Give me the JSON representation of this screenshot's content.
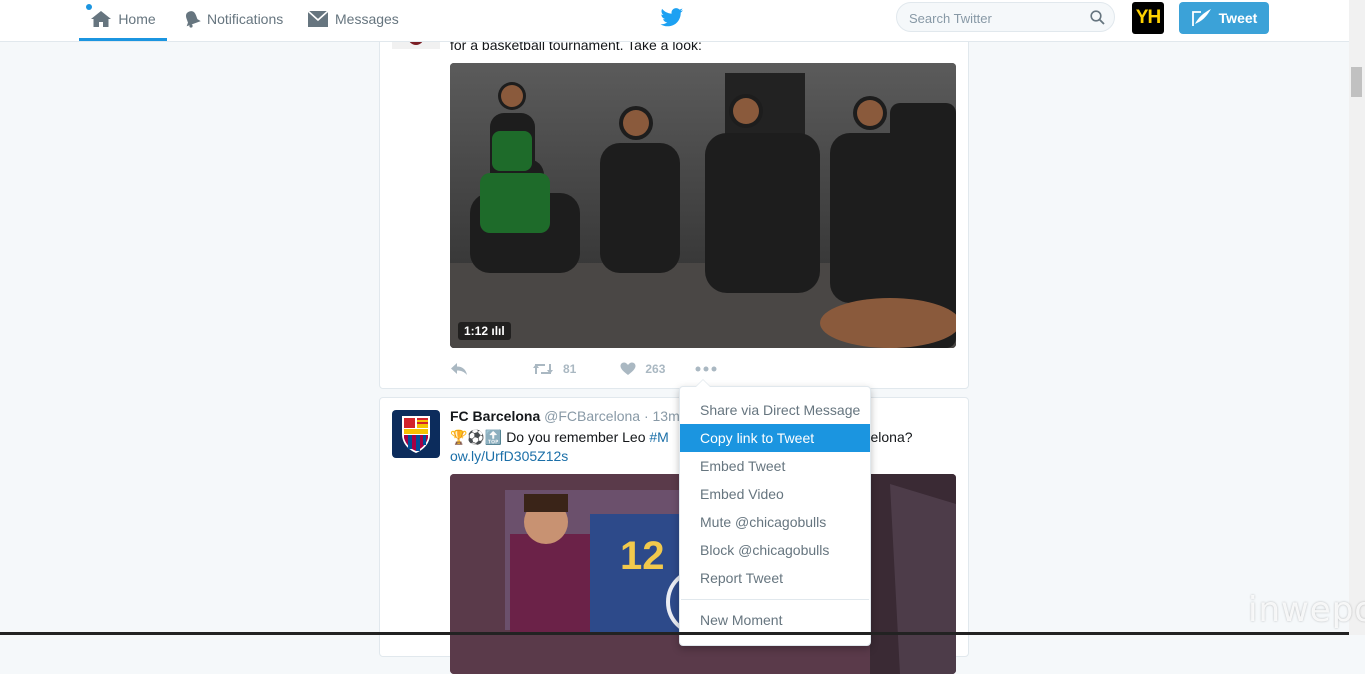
{
  "nav": {
    "home_label": "Home",
    "notifications_label": "Notifications",
    "messages_label": "Messages",
    "search_placeholder": "Search Twitter",
    "user_initials": "YH",
    "tweet_button_label": "Tweet"
  },
  "tweets": [
    {
      "text": "for a basketball tournament. Take a look:",
      "video_duration": "1:12",
      "retweets": "81",
      "likes": "263"
    },
    {
      "name": "FC Barcelona",
      "handle": "@FCBarcelona",
      "time": "13m",
      "body_emoji": "🏆⚽🔝",
      "body_text_a": "Do you remember Leo",
      "body_hashtag": "#M",
      "body_text_b": "rcelona?",
      "link": "ow.ly/UrfD305Z12s",
      "media_number": "12"
    }
  ],
  "menu": {
    "items": [
      "Share via Direct Message",
      "Copy link to Tweet",
      "Embed Tweet",
      "Embed Video",
      "Mute @chicagobulls",
      "Block @chicagobulls",
      "Report Tweet"
    ],
    "active_index": 1,
    "footer_item": "New Moment"
  },
  "watermark": "inwepo",
  "colors": {
    "accent": "#1b95e0",
    "tweet_button": "#3ba2d8",
    "background": "#f5f8fa"
  }
}
